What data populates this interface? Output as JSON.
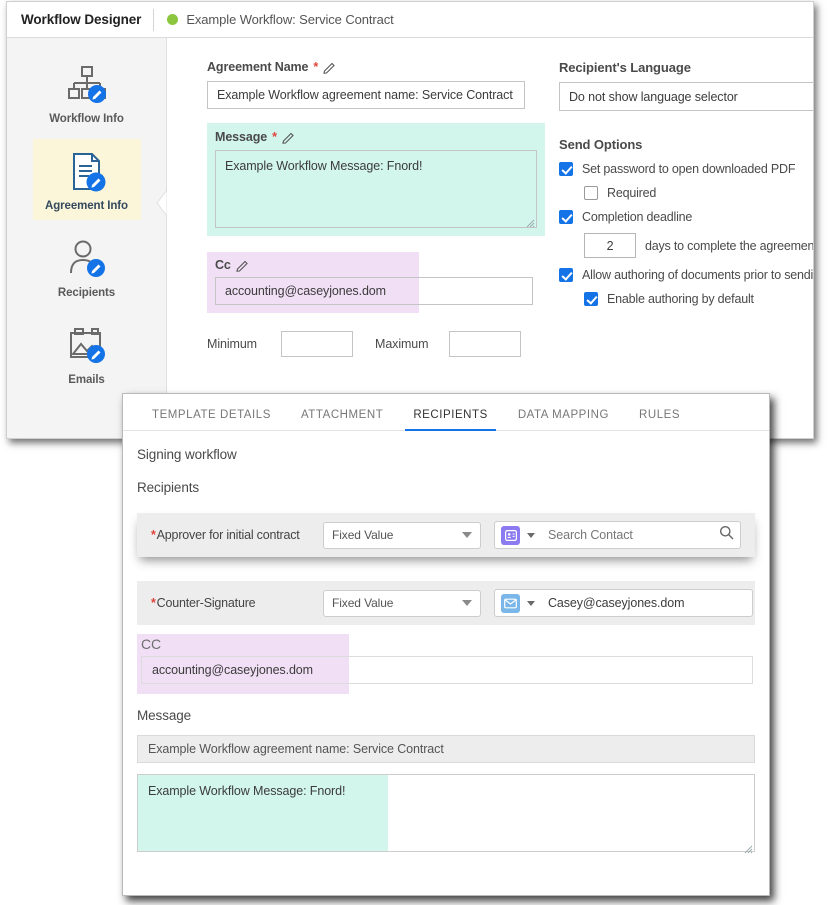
{
  "designer": {
    "title": "Workflow Designer",
    "workflow_name": "Example Workflow: Service Contract",
    "status_color": "#8cc63e",
    "rail": [
      {
        "label": "Workflow Info",
        "icon": "workflow-tree-edit-icon"
      },
      {
        "label": "Agreement Info",
        "icon": "document-edit-icon"
      },
      {
        "label": "Recipients",
        "icon": "person-edit-icon"
      },
      {
        "label": "Emails",
        "icon": "image-mail-edit-icon"
      }
    ],
    "agreement_name": {
      "label": "Agreement Name",
      "required_mark": "*",
      "value": "Example Workflow agreement name: Service Contract"
    },
    "message": {
      "label": "Message",
      "required_mark": "*",
      "value": "Example Workflow Message: Fnord!",
      "highlight_color": "#d2f5ec"
    },
    "cc": {
      "label": "Cc",
      "value": "accounting@caseyjones.dom",
      "highlight_color": "#f0dff5"
    },
    "minmax": {
      "minimum_label": "Minimum",
      "minimum_value": "",
      "maximum_label": "Maximum",
      "maximum_value": ""
    },
    "language": {
      "label": "Recipient's Language",
      "value": "Do not show language selector"
    },
    "send_options": {
      "title": "Send Options",
      "items": [
        {
          "label": "Set password to open downloaded PDF",
          "checked": true,
          "indent": false
        },
        {
          "label": "Required",
          "checked": false,
          "indent": true
        },
        {
          "label": "Completion deadline",
          "checked": true,
          "indent": false
        },
        {
          "label": "Allow authoring of documents prior to sending",
          "checked": true,
          "indent": false
        },
        {
          "label": "Enable authoring by default",
          "checked": true,
          "indent": true
        }
      ],
      "days_value": "2",
      "days_suffix": "days to complete the agreement"
    }
  },
  "overlay": {
    "tabs": [
      {
        "label": "TEMPLATE DETAILS",
        "active": false
      },
      {
        "label": "ATTACHMENT",
        "active": false
      },
      {
        "label": "RECIPIENTS",
        "active": true
      },
      {
        "label": "DATA MAPPING",
        "active": false
      },
      {
        "label": "RULES",
        "active": false
      }
    ],
    "active_tab_color": "#1473e6",
    "signing_workflow_title": "Signing workflow",
    "recipients_title": "Recipients",
    "recipient_rows": [
      {
        "required_mark": "*",
        "name": "Approver for initial contract",
        "select_value": "Fixed Value",
        "type_icon": "id-badge-icon",
        "type_icon_color": "#8c7bf0",
        "contact_value": "Search Contact",
        "contact_filled": false,
        "search_icon": "search-icon"
      },
      {
        "required_mark": "*",
        "name": "Counter-Signature",
        "select_value": "Fixed Value",
        "type_icon": "envelope-icon",
        "type_icon_color": "#7ab6e8",
        "contact_value": "Casey@caseyjones.dom",
        "contact_filled": true,
        "search_icon": ""
      }
    ],
    "cc": {
      "label": "CC",
      "value": "accounting@caseyjones.dom",
      "highlight_color": "#f0dff5"
    },
    "message_title": "Message",
    "subject_value": "Example Workflow agreement name: Service Contract",
    "message_value": "Example Workflow Message: Fnord!",
    "message_highlight_color": "#d2f5ec"
  }
}
